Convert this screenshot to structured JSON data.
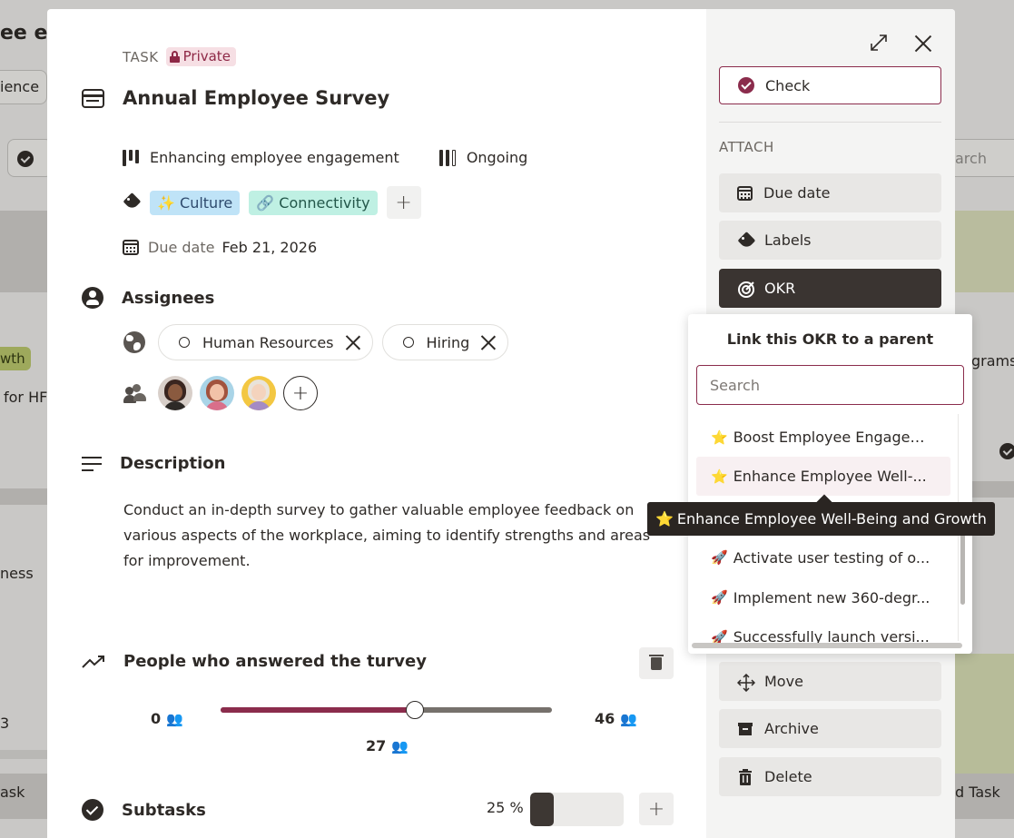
{
  "background": {
    "title_fragment": "ee en",
    "pill_fragment": "ience",
    "search_fragment": "arch",
    "tag_fragment": "wth",
    "left_text_1": "for HF",
    "left_text_2": "ness",
    "left_number": "3",
    "left_text_3": "ask",
    "right_text_1": "grams",
    "right_text_2": "d Task"
  },
  "task": {
    "type_label": "TASK",
    "privacy_label": "Private",
    "title": "Annual Employee Survey",
    "project": "Enhancing employee engagement",
    "status": "Ongoing",
    "labels": [
      {
        "emoji": "✨",
        "text": "Culture"
      },
      {
        "emoji": "🔗",
        "text": "Connectivity"
      }
    ],
    "add_label": "+",
    "due_date_label": "Due date",
    "due_date_value": "Feb 21, 2026"
  },
  "assignees": {
    "heading": "Assignees",
    "groups": [
      {
        "name": "Human Resources"
      },
      {
        "name": "Hiring"
      }
    ],
    "add_symbol": "+"
  },
  "description": {
    "heading": "Description",
    "text": "Conduct an in-depth survey to gather valuable employee feedback on various aspects of the workplace, aiming to identify strengths and areas for improvement."
  },
  "metric": {
    "heading": "People who answered the turvey",
    "min": "0",
    "max": "46",
    "current": "27",
    "unit_emoji": "👥",
    "fraction": 0.587
  },
  "subtasks": {
    "heading": "Subtasks",
    "percent_label": "25 %",
    "fraction": 0.25,
    "add_symbol": "+"
  },
  "side": {
    "check_label": "Check",
    "attach_heading": "ATTACH",
    "actions": {
      "due_date": "Due date",
      "labels": "Labels",
      "okr": "OKR",
      "move": "Move",
      "archive": "Archive",
      "delete": "Delete"
    }
  },
  "okr_popup": {
    "title": "Link this OKR to a parent",
    "search_placeholder": "Search",
    "items": [
      {
        "emoji": "⭐",
        "text": "Boost Employee Engagem..."
      },
      {
        "emoji": "⭐",
        "text": "Enhance Employee Well-..."
      },
      {
        "emoji": "🚀",
        "text": "Activate user testing of o..."
      },
      {
        "emoji": "🚀",
        "text": "Implement new 360-degr..."
      },
      {
        "emoji": "🚀",
        "text": "Successfully launch versi..."
      }
    ],
    "tooltip_emoji": "⭐",
    "tooltip_text": "Enhance Employee Well-Being and Growth"
  },
  "colors": {
    "accent": "#8b2c4c",
    "dark": "#3a3431",
    "slider_track": "#76716c"
  }
}
